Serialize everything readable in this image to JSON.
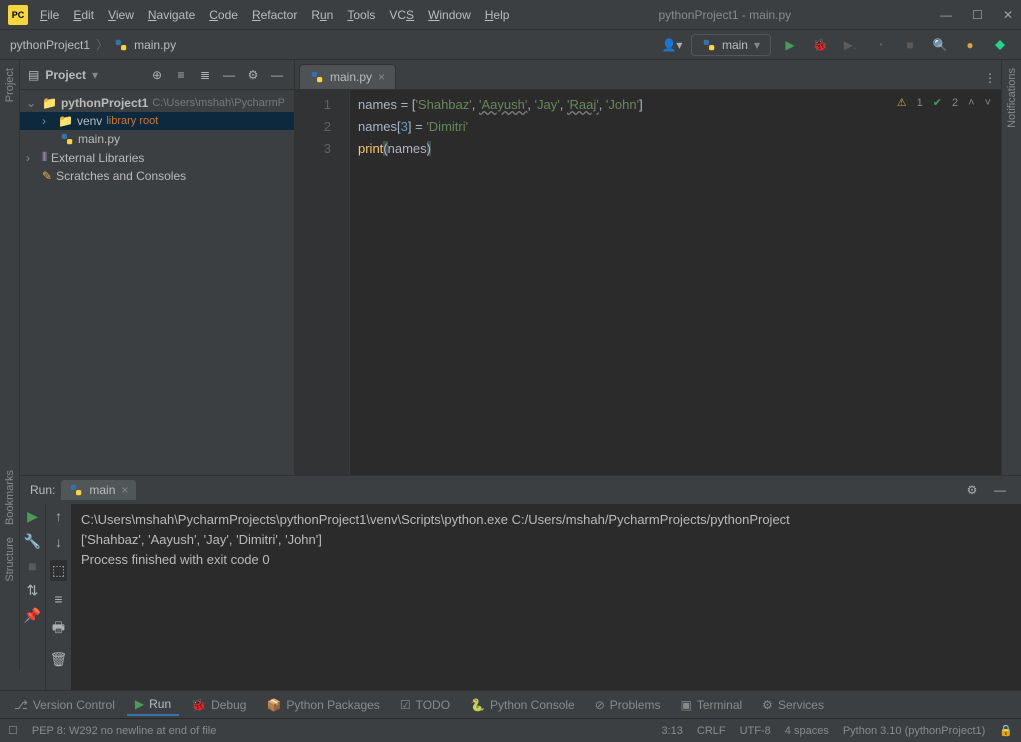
{
  "window": {
    "title": "pythonProject1 - main.py",
    "logo": "PC"
  },
  "menu": [
    "File",
    "Edit",
    "View",
    "Navigate",
    "Code",
    "Refactor",
    "Run",
    "Tools",
    "VCS",
    "Window",
    "Help"
  ],
  "breadcrumb": {
    "project": "pythonProject1",
    "file": "main.py"
  },
  "runConfig": {
    "name": "main"
  },
  "projectPanel": {
    "title": "Project",
    "root": {
      "name": "pythonProject1",
      "path": "C:\\Users\\mshah\\PycharmP"
    },
    "venv": {
      "name": "venv",
      "tag": "library root"
    },
    "file": "main.py",
    "external": "External Libraries",
    "scratches": "Scratches and Consoles"
  },
  "editor": {
    "tab": "main.py",
    "lineNumbers": [
      "1",
      "2",
      "3"
    ],
    "warnCount": "1",
    "okCount": "2"
  },
  "code": {
    "l1_a": "names = [",
    "l1_s1": "'Shahbaz'",
    "l1_c1": ", ",
    "l1_s2": "'Aayush'",
    "l1_c2": ", ",
    "l1_s3": "'Jay'",
    "l1_c3": ", ",
    "l1_s4": "'Raaj'",
    "l1_c4": ", ",
    "l1_s5": "'John'",
    "l1_b": "]",
    "l2_a": "names[",
    "l2_n": "3",
    "l2_b": "] = ",
    "l2_s": "'Dimitri'",
    "l3_fn": "print",
    "l3_a": "(",
    "l3_v": "names",
    "l3_b": ")"
  },
  "run": {
    "label": "Run:",
    "tabName": "main",
    "line1": "C:\\Users\\mshah\\PycharmProjects\\pythonProject1\\venv\\Scripts\\python.exe C:/Users/mshah/PycharmProjects/pythonProject",
    "line2": "['Shahbaz', 'Aayush', 'Jay', 'Dimitri', 'John']",
    "line3": "",
    "line4": "Process finished with exit code 0"
  },
  "bottomTools": {
    "vcs": "Version Control",
    "run": "Run",
    "debug": "Debug",
    "pkg": "Python Packages",
    "todo": "TODO",
    "pyconsole": "Python Console",
    "problems": "Problems",
    "terminal": "Terminal",
    "services": "Services"
  },
  "status": {
    "msg": "PEP 8: W292 no newline at end of file",
    "pos": "3:13",
    "eol": "CRLF",
    "enc": "UTF-8",
    "indent": "4 spaces",
    "interp": "Python 3.10 (pythonProject1)"
  },
  "sidebars": {
    "project": "Project",
    "bookmarks": "Bookmarks",
    "structure": "Structure",
    "notifications": "Notifications"
  }
}
